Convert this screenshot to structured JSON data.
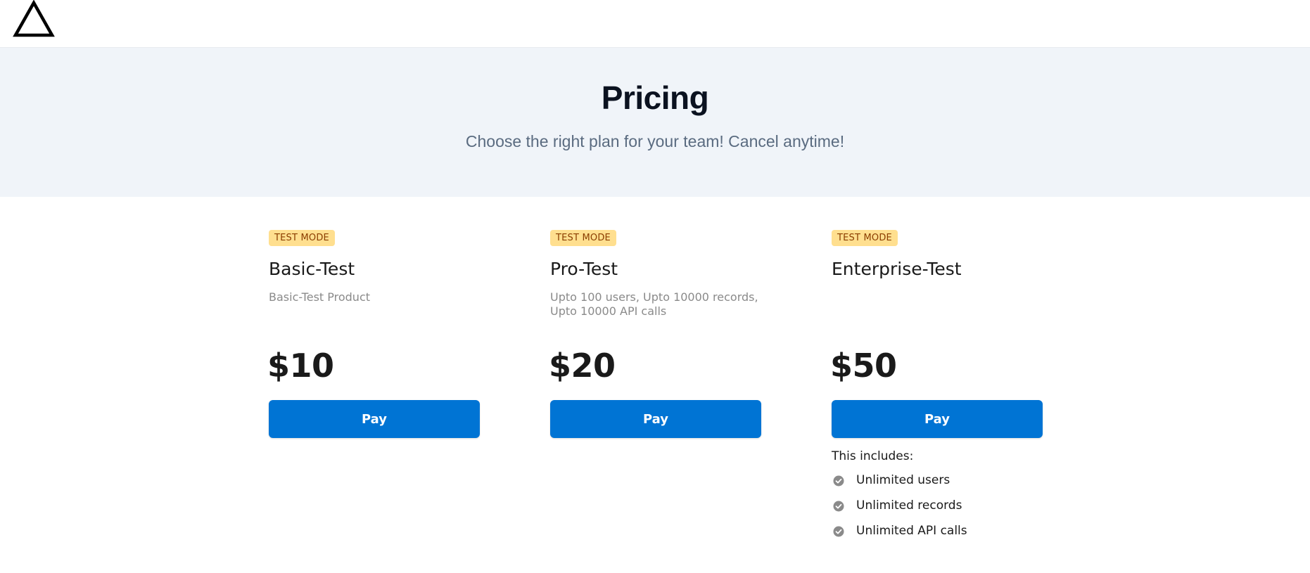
{
  "header": {
    "logo_icon": "triangle-outline-icon"
  },
  "hero": {
    "title": "Pricing",
    "subtitle": "Choose the right plan for your team! Cancel anytime!"
  },
  "plans": [
    {
      "badge": "TEST MODE",
      "name": "Basic-Test",
      "description": "Basic-Test Product",
      "price": "$10",
      "button_label": "Pay"
    },
    {
      "badge": "TEST MODE",
      "name": "Pro-Test",
      "description": "Upto 100 users, Upto 10000 records, Upto 10000 API calls",
      "price": "$20",
      "button_label": "Pay"
    },
    {
      "badge": "TEST MODE",
      "name": "Enterprise-Test",
      "description": "",
      "price": "$50",
      "button_label": "Pay",
      "includes_label": "This includes:",
      "features": [
        "Unlimited users",
        "Unlimited records",
        "Unlimited API calls"
      ]
    }
  ],
  "colors": {
    "accent": "#0074d4",
    "badge_bg": "#ffdf8f",
    "badge_text": "#8a3d00",
    "hero_bg": "#f0f4f9"
  }
}
